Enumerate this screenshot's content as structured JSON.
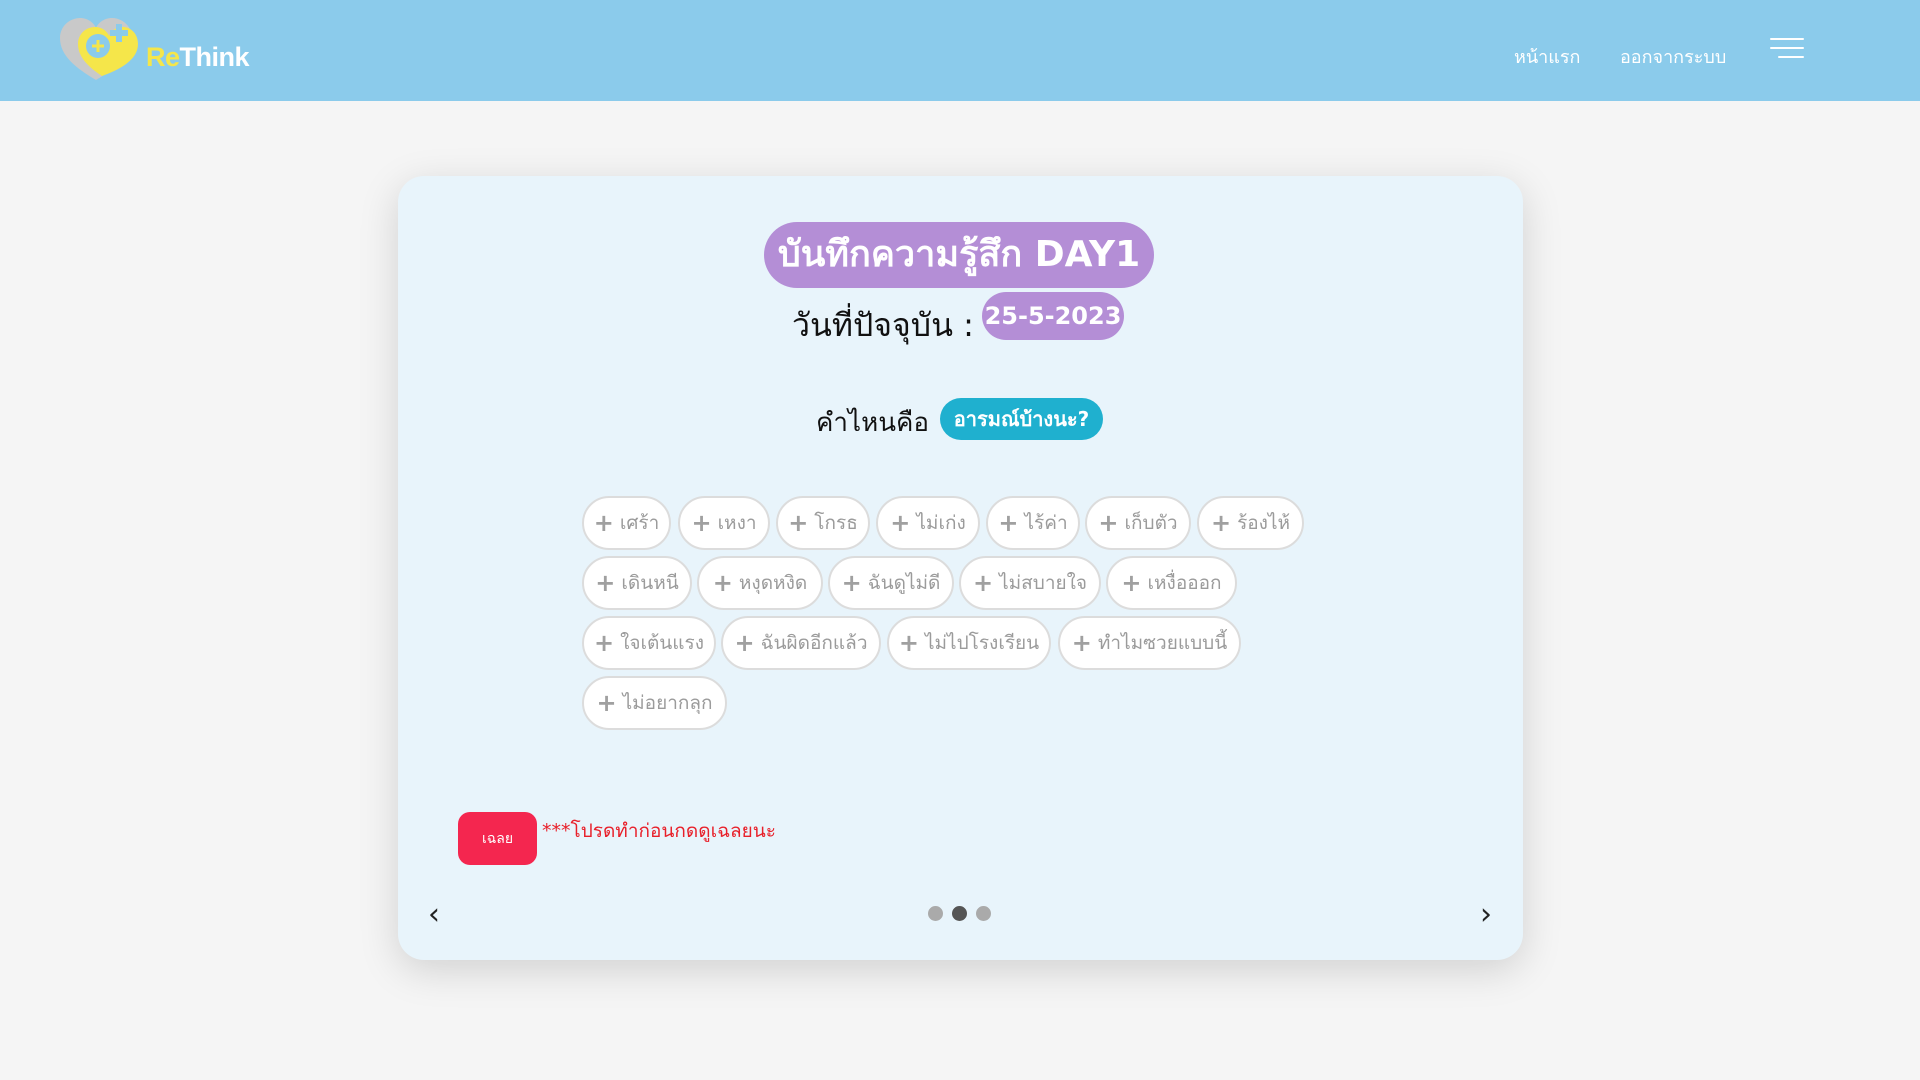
{
  "header": {
    "logo_re": "Re",
    "logo_think": "Think",
    "nav_home": "หน้าแรก",
    "nav_logout": "ออกจากระบบ",
    "menu_icon": "hamburger-icon",
    "bg_color": "#8bcbeb"
  },
  "card": {
    "title": "บันทึกความรู้สึก DAY1",
    "date_label": "วันที่ปัจจุบัน :",
    "date_value": "25-5-2023",
    "question_label": "คำไหนคือ",
    "question_pill": "อารมณ์บ้างนะ?",
    "tags": [
      "เศร้า",
      "เหงา",
      "โกรธ",
      "ไม่เก่ง",
      "ไร้ค่า",
      "เก็บตัว",
      "ร้องไห้",
      "เดินหนี",
      "หงุดหงิด",
      "ฉันดูไม่ดี",
      "ไม่สบายใจ",
      "เหงื่อออก",
      "ใจเต้นแรง",
      "ฉันผิดอีกแล้ว",
      "ไม่ไปโรงเรียน",
      "ทำไมซวยแบบนี้",
      "ไม่อยากลุก"
    ],
    "answer_button": "เฉลย",
    "hint": "***โปรดทำก่อนกดดูเฉลยนะ",
    "prev_arrow": "‹",
    "next_arrow": "›",
    "carousel_total": 3,
    "carousel_active": 2,
    "accent_purple": "#b48ed6",
    "accent_cyan": "#1fb0cf",
    "accent_red": "#f4264f"
  }
}
